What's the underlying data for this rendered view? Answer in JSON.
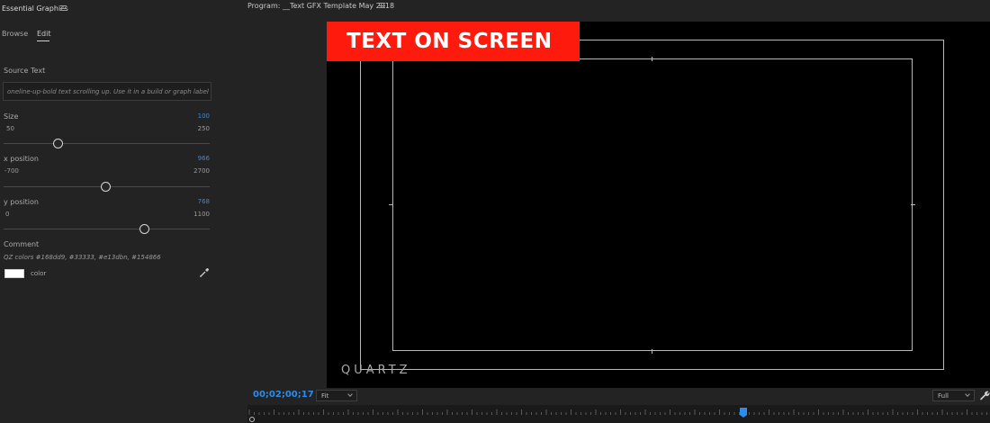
{
  "panel": {
    "title": "Essential Graphics",
    "tabs": [
      {
        "label": "Browse",
        "active": false
      },
      {
        "label": "Edit",
        "active": true
      }
    ],
    "source_text": {
      "label": "Source Text",
      "value": "oneline-up-bold text scrolling up. Use it in a build or graph label"
    },
    "size": {
      "label": "Size",
      "value": "100",
      "min": "50",
      "max": "250"
    },
    "x_position": {
      "label": "x position",
      "value": "966",
      "min": "-700",
      "max": "2700"
    },
    "y_position": {
      "label": "y position",
      "value": "768",
      "min": "0",
      "max": "1100"
    },
    "comment": {
      "label": "Comment",
      "text": "QZ colors #168dd9, #33333, #e13dbn, #154866"
    },
    "color": {
      "label": "color",
      "swatch": "#ffffff",
      "icon": "eyedropper-icon"
    }
  },
  "program": {
    "title": "Program: __Text GFX Template May 2018",
    "banner_text": "TEXT ON SCREEN",
    "banner_color": "#ff1a0e",
    "logo_text": "QUARTZ",
    "timecode": "00;02;00;17",
    "fit_label": "Fit",
    "resolution_label": "Full",
    "wrench_icon": "wrench-icon",
    "accent": "#2d8ceb"
  }
}
